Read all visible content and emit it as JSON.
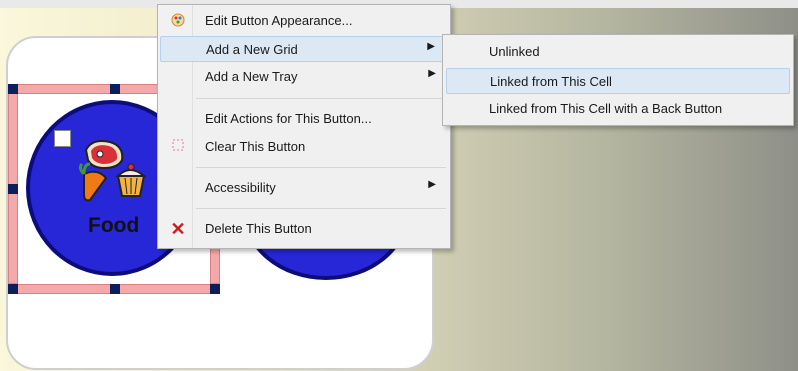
{
  "board": {
    "cells": [
      {
        "label": "Food",
        "color": "#2727d8"
      },
      {
        "label": "",
        "color": "#2727d8"
      }
    ]
  },
  "context_menu": {
    "items": [
      {
        "label": "Edit Button Appearance...",
        "icon": "palette-icon"
      },
      {
        "label": "Add a New Grid",
        "submenu": true,
        "highlighted": true
      },
      {
        "label": "Add a New Tray",
        "submenu": true
      },
      {
        "label": "Edit Actions for This Button...",
        "icon": ""
      },
      {
        "label": "Clear This Button",
        "icon": "clear-dashed-icon"
      },
      {
        "label": "Accessibility",
        "submenu": true
      },
      {
        "label": "Delete This Button",
        "icon": "red-x-icon"
      }
    ]
  },
  "submenu": {
    "items": [
      {
        "label": "Unlinked"
      },
      {
        "label": "Linked from This Cell",
        "highlighted": true
      },
      {
        "label": "Linked from This Cell with a Back Button"
      }
    ]
  },
  "colors": {
    "highlight": "#dce8f4",
    "delete_icon": "#d11c1c",
    "button_fill": "#2727d8"
  }
}
